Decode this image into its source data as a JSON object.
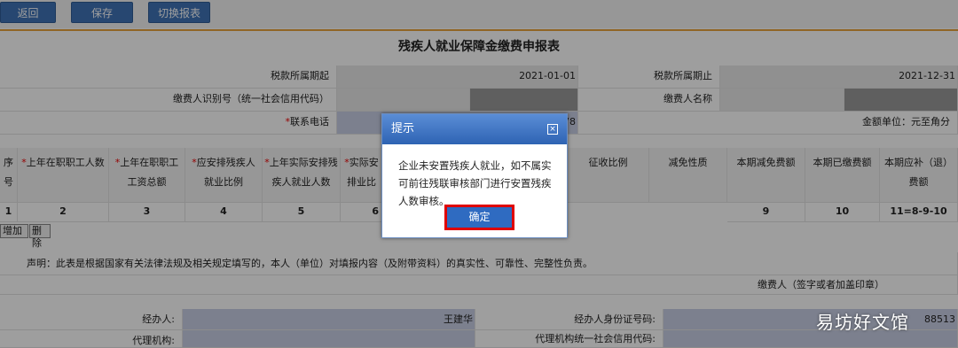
{
  "toolbar": {
    "back_label": "返回",
    "save_label": "保存",
    "switch_label": "切换报表"
  },
  "form": {
    "title": "残疾人就业保障金缴费申报表",
    "period_start_label": "税款所属期起",
    "period_start_value": "2021-01-01",
    "period_end_label": "税款所属期止",
    "period_end_value": "2021-12-31",
    "taxpayer_id_label": "缴费人识别号（统一社会信用代码）",
    "taxpayer_name_label": "缴费人名称",
    "phone_required": "*",
    "phone_label": "联系电话",
    "phone_partial": "78",
    "amount_unit": "金额单位：元至角分"
  },
  "table": {
    "headers": [
      {
        "req": "",
        "text": "序号"
      },
      {
        "req": "*",
        "text": "上年在职职工人数"
      },
      {
        "req": "*",
        "text": "上年在职职工工资总额"
      },
      {
        "req": "*",
        "text": "应安排残疾人就业比例"
      },
      {
        "req": "*",
        "text": "上年实际安排残疾人就业人数"
      },
      {
        "req": "*",
        "text": "实际安排业比"
      },
      {
        "req": "",
        "text": "征收比例"
      },
      {
        "req": "",
        "text": "减免性质"
      },
      {
        "req": "",
        "text": "本期减免费额"
      },
      {
        "req": "",
        "text": "本期已缴费额"
      },
      {
        "req": "",
        "text": "本期应补（退）费额"
      }
    ],
    "numbers": [
      "1",
      "2",
      "3",
      "4",
      "5",
      "6",
      "9",
      "10",
      "11=8-9-10"
    ],
    "add_row_label": "增加一行",
    "delete_label": "删除"
  },
  "declaration": "声明：此表是根据国家有关法律法规及相关规定填写的，本人（单位）对填报内容（及附带资料）的真实性、可靠性、完整性负责。",
  "signature": "缴费人（签字或者加盖印章）",
  "agent": {
    "handler_label": "经办人:",
    "handler_value": "王建华",
    "handler_id_label": "经办人身份证号码:",
    "handler_id_partial": "88513",
    "agency_label": "代理机构:",
    "agency_code_label": "代理机构统一社会信用代码:"
  },
  "dialog": {
    "title": "提示",
    "close_symbol": "×",
    "message": "企业未安置残疾人就业，如不属实可前往残联审核部门进行安置残疾人数审核。",
    "ok_label": "确定"
  },
  "watermark": "易坊好文馆"
}
